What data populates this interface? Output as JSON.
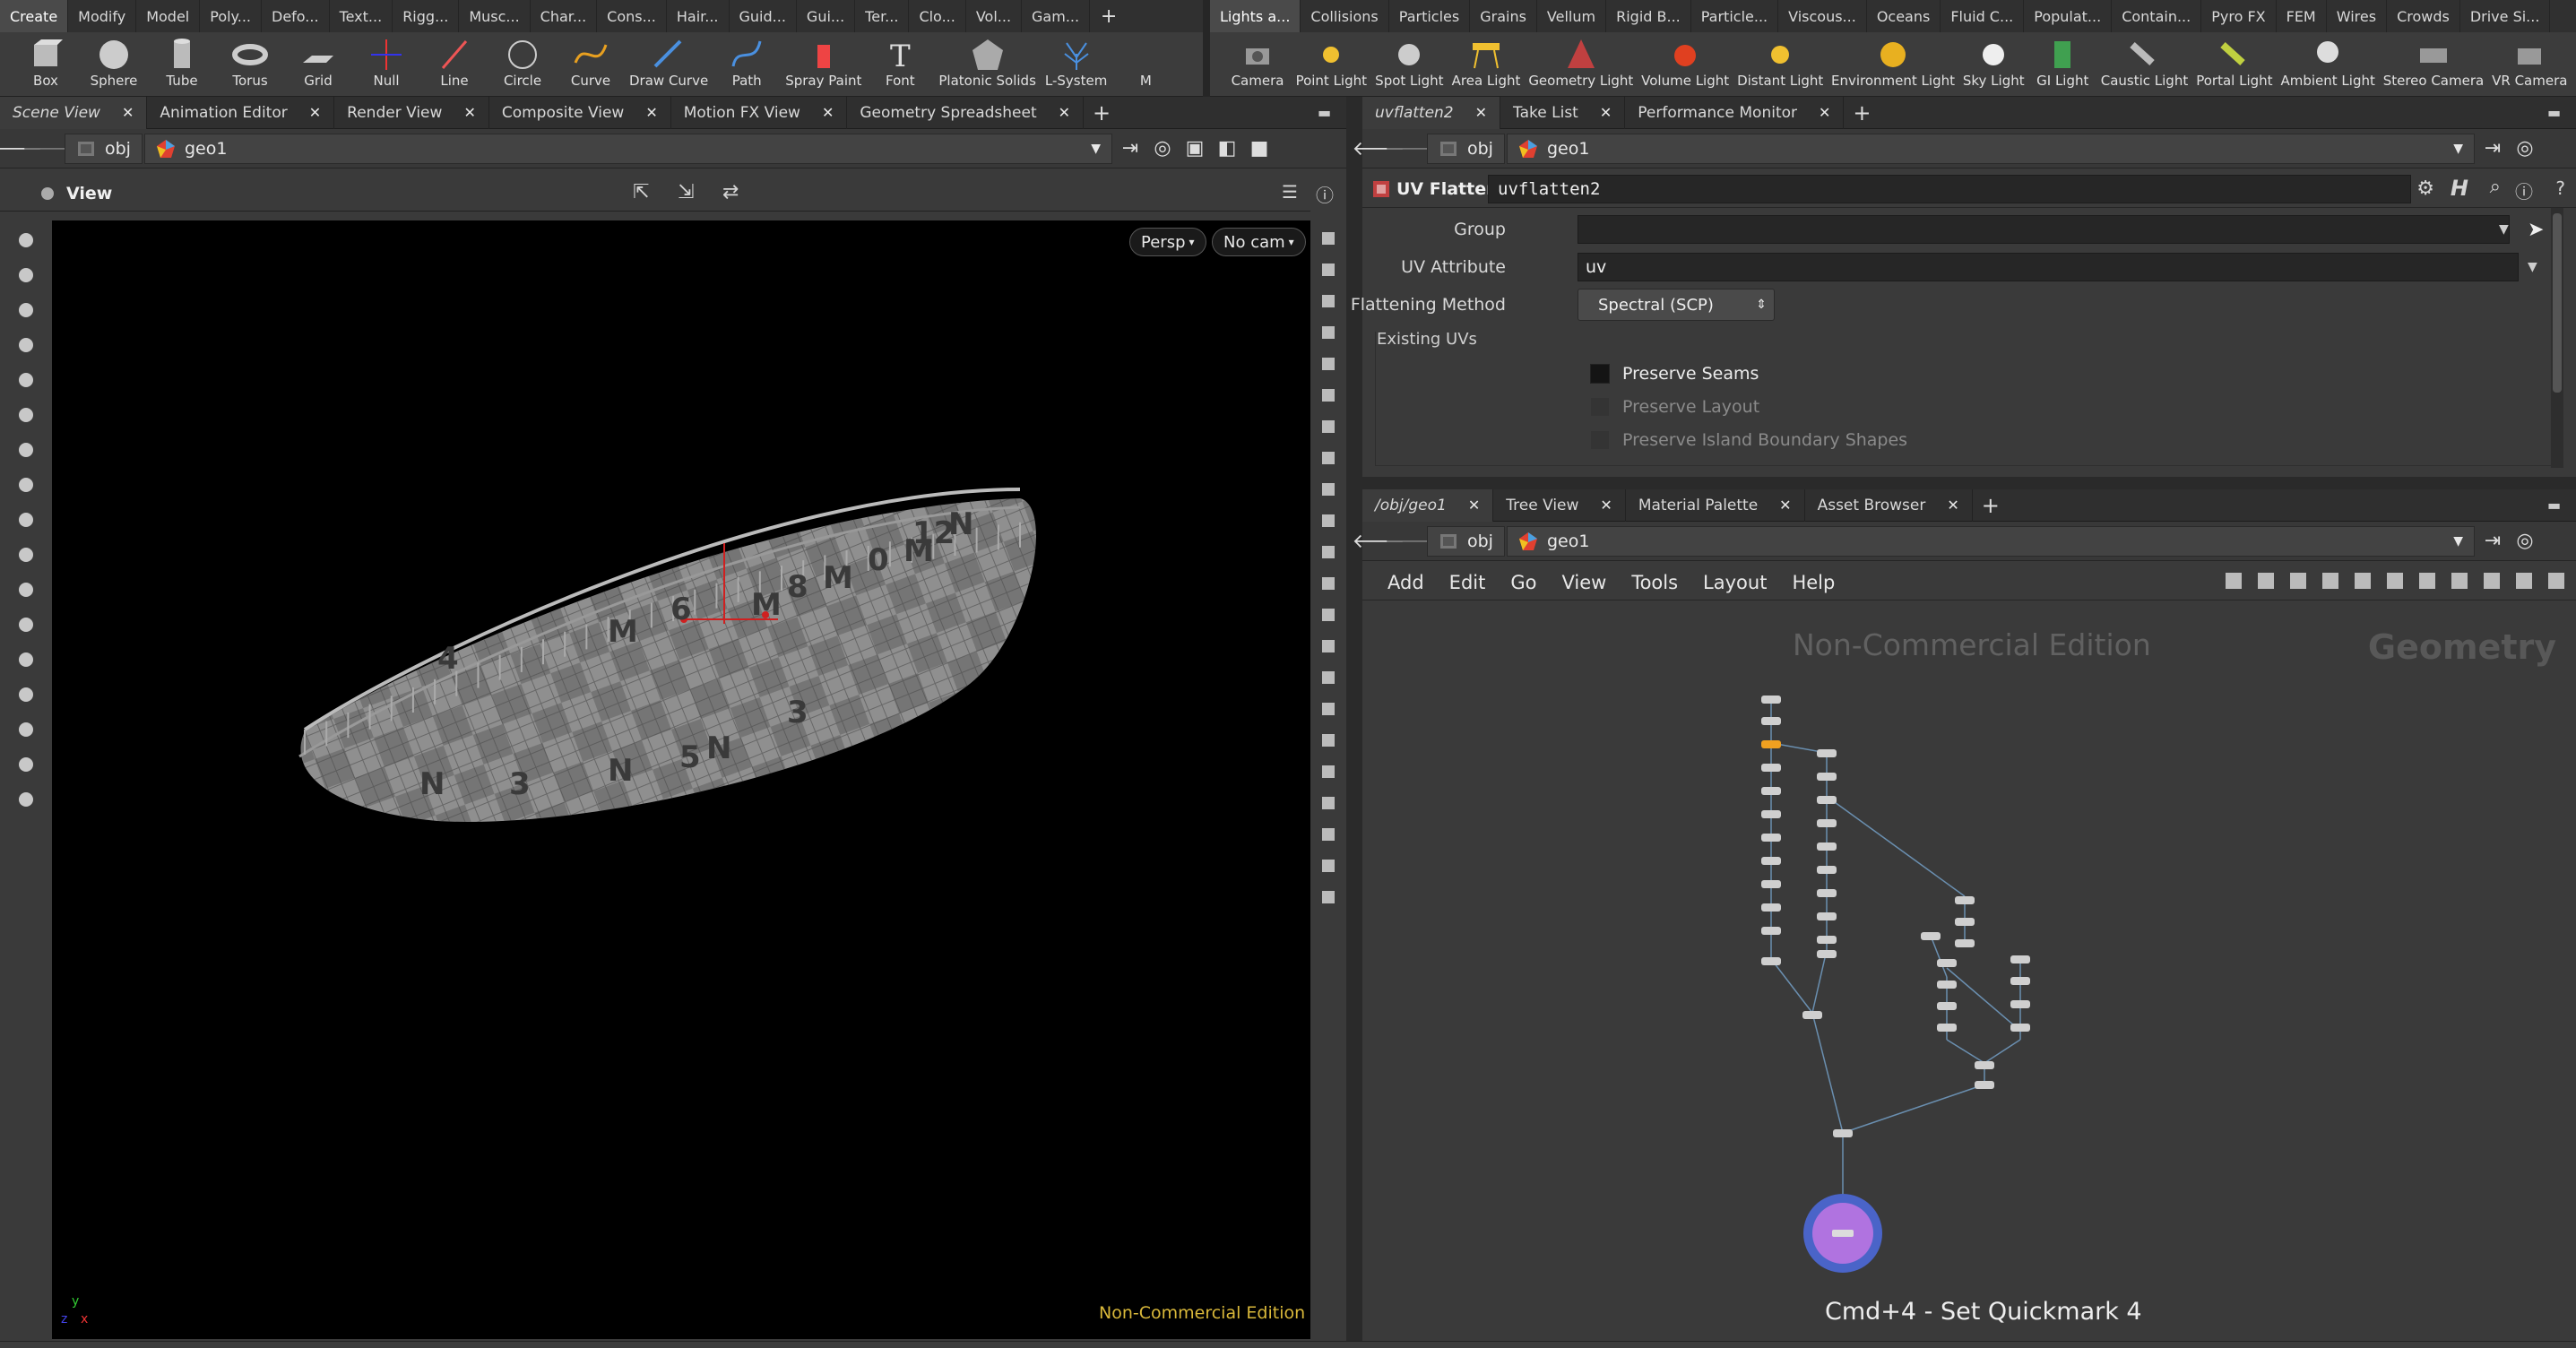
{
  "shelf_left": {
    "tabs": [
      "Create",
      "Modify",
      "Model",
      "Poly...",
      "Defo...",
      "Text...",
      "Rigg...",
      "Musc...",
      "Char...",
      "Cons...",
      "Hair...",
      "Guid...",
      "Gui...",
      "Ter...",
      "Clo...",
      "Vol...",
      "Gam..."
    ],
    "plus": "+",
    "tools": [
      "Box",
      "Sphere",
      "Tube",
      "Torus",
      "Grid",
      "Null",
      "Line",
      "Circle",
      "Curve",
      "Draw Curve",
      "Path",
      "Spray Paint",
      "Font",
      "Platonic Solids",
      "L-System",
      "M"
    ]
  },
  "shelf_right": {
    "tabs": [
      "Lights a...",
      "Collisions",
      "Particles",
      "Grains",
      "Vellum",
      "Rigid B...",
      "Particle...",
      "Viscous...",
      "Oceans",
      "Fluid C...",
      "Populat...",
      "Contain...",
      "Pyro FX",
      "FEM",
      "Wires",
      "Crowds",
      "Drive Si..."
    ],
    "tools": [
      "Camera",
      "Point Light",
      "Spot Light",
      "Area Light",
      "Geometry Light",
      "Volume Light",
      "Distant Light",
      "Environment Light",
      "Sky Light",
      "GI Light",
      "Caustic Light",
      "Portal Light",
      "Ambient Light",
      "Stereo Camera",
      "VR Camera"
    ]
  },
  "left_pane": {
    "tabs": [
      "Scene View",
      "Animation Editor",
      "Render View",
      "Composite View",
      "Motion FX View",
      "Geometry Spreadsheet"
    ],
    "path": [
      "obj",
      "geo1"
    ],
    "viewer_title": "View",
    "persp_label": "Persp",
    "cam_label": "No cam",
    "watermark": "Non-Commercial Edition",
    "uv_labels": [
      "N",
      "3",
      "N",
      "5",
      "N",
      "3",
      "4",
      "M",
      "6",
      "M",
      "8",
      "M",
      "0",
      "M",
      "12",
      "N"
    ],
    "axis": {
      "x": "x",
      "y": "y",
      "z": "z"
    }
  },
  "param_pane": {
    "tabs": [
      "uvflatten2",
      "Take List",
      "Performance Monitor"
    ],
    "path": [
      "obj",
      "geo1"
    ],
    "node_type": "UV Flatten",
    "node_name": "uvflatten2",
    "group_label": "Group",
    "group_value": "",
    "uv_attribute_label": "UV Attribute",
    "uv_attribute_value": "uv",
    "flattening_method_label": "Flattening Method",
    "flattening_method_value": "Spectral (SCP)",
    "existing_uvs_label": "Existing UVs",
    "preserve_seams": "Preserve Seams",
    "preserve_layout": "Preserve Layout",
    "preserve_island": "Preserve Island Boundary Shapes"
  },
  "network_pane": {
    "tabs": [
      "/obj/geo1",
      "Tree View",
      "Material Palette",
      "Asset Browser"
    ],
    "path": [
      "obj",
      "geo1"
    ],
    "menu": [
      "Add",
      "Edit",
      "Go",
      "View",
      "Tools",
      "Layout",
      "Help"
    ],
    "watermark": "Non-Commercial Edition",
    "context_label": "Geometry",
    "quickmark": "Cmd+4 - Set Quickmark 4"
  },
  "colors": {
    "accent": "#f0a020",
    "node_flag": "#9a5cd6",
    "watermark_vp": "#d9b83a"
  }
}
